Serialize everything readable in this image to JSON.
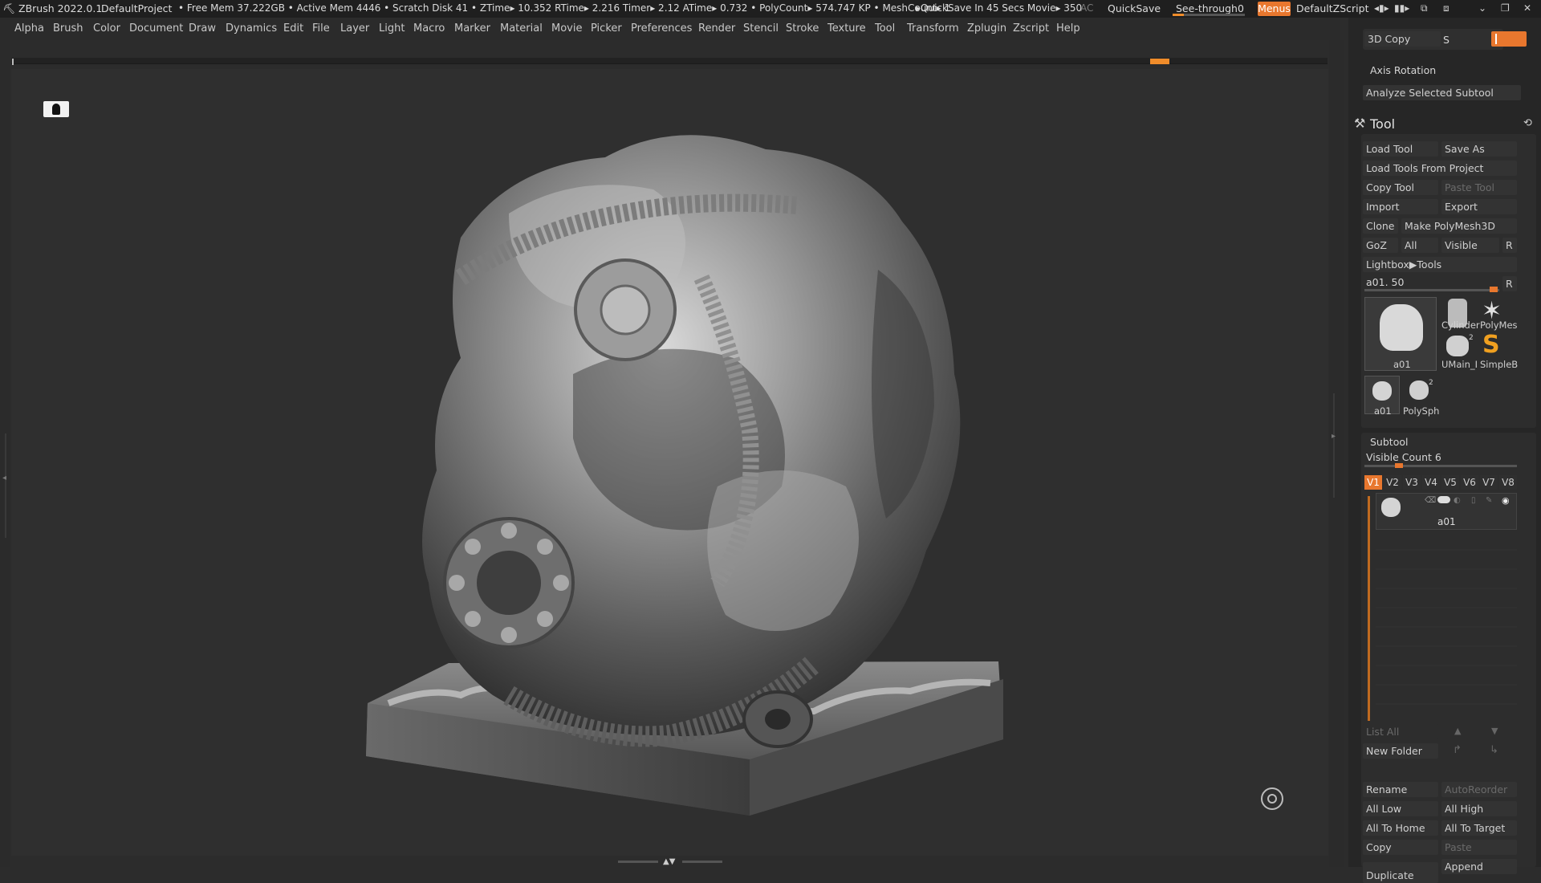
{
  "titlebar": {
    "app": "ZBrush 2022.0.1",
    "project": "DefaultProject",
    "stats": "• Free Mem 37.222GB • Active Mem 4446 • Scratch Disk 41 •  ZTime▸ 10.352 RTime▸ 2.216 Timer▸ 2.12 ATime▸ 0.732 • PolyCount▸ 574.747 KP  • MeshCount▸ 1",
    "quicksave_info": "▸QuickSave In 45 Secs Movie▸ 350",
    "ac": "AC",
    "quicksave": "QuickSave",
    "see_through_label": "See-through",
    "see_through_value": "0",
    "see_through_fraction": 0.15,
    "menus": "Menus",
    "zscript": "DefaultZScript",
    "accent_color": "#e8772e"
  },
  "menubar": [
    "Alpha",
    "Brush",
    "Color",
    "Document",
    "Draw",
    "Dynamics",
    "Edit",
    "File",
    "Layer",
    "Light",
    "Macro",
    "Marker",
    "Material",
    "Movie",
    "Picker",
    "Preferences",
    "Render",
    "Stencil",
    "Stroke",
    "Texture",
    "Tool",
    "Transform",
    "Zplugin",
    "Zscript",
    "Help"
  ],
  "panel": {
    "top": {
      "copy_3d": "3D Copy",
      "s_label": "S",
      "axis_rotation": "Axis Rotation",
      "analyze": "Analyze Selected Subtool"
    },
    "tool": {
      "title": "Tool",
      "load_tool": "Load Tool",
      "save_as": "Save As",
      "load_from_project": "Load Tools From Project",
      "copy_tool": "Copy Tool",
      "paste_tool": "Paste Tool",
      "import": "Import",
      "export": "Export",
      "clone": "Clone",
      "make_polymesh": "Make PolyMesh3D",
      "goz": "GoZ",
      "all": "All",
      "visible": "Visible",
      "r": "R",
      "lightbox": "Lightbox▶Tools",
      "slider_label": "a01. 50",
      "slider_r": "R",
      "thumbnails": {
        "main": "a01",
        "cylinder": "Cylinder",
        "polymesh": "PolyMes",
        "umain": "UMain_I",
        "umain_count": "2",
        "simpleb": "SimpleB",
        "small_a01": "a01",
        "polysph": "PolySph",
        "polysph_count": "2"
      }
    },
    "subtool": {
      "title": "Subtool",
      "visible_count": "Visible Count 6",
      "tabs": [
        "V1",
        "V2",
        "V3",
        "V4",
        "V5",
        "V6",
        "V7",
        "V8"
      ],
      "active_tab": "V1",
      "item_name": "a01",
      "list_all": "List All",
      "new_folder": "New Folder",
      "rename": "Rename",
      "autoreorder": "AutoReorder",
      "all_low": "All Low",
      "all_high": "All High",
      "all_to_home": "All To Home",
      "all_to_target": "All To Target",
      "copy": "Copy",
      "paste": "Paste",
      "append": "Append",
      "duplicate": "Duplicate"
    }
  },
  "viewport": {
    "model_description_icon": "sculpt-model"
  }
}
